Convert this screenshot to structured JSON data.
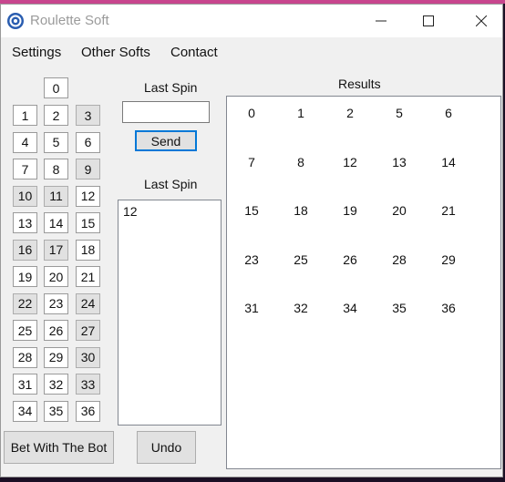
{
  "window": {
    "title": "Roulette Soft",
    "controls": [
      "minimize-icon",
      "maximize-icon",
      "close-icon"
    ]
  },
  "menu": [
    "Settings",
    "Other Softs",
    "Contact"
  ],
  "number_grid": {
    "zero": "0",
    "rows": [
      [
        "1",
        "2",
        "3"
      ],
      [
        "4",
        "5",
        "6"
      ],
      [
        "7",
        "8",
        "9"
      ],
      [
        "10",
        "11",
        "12"
      ],
      [
        "13",
        "14",
        "15"
      ],
      [
        "16",
        "17",
        "18"
      ],
      [
        "19",
        "20",
        "21"
      ],
      [
        "22",
        "23",
        "24"
      ],
      [
        "25",
        "26",
        "27"
      ],
      [
        "28",
        "29",
        "30"
      ],
      [
        "31",
        "32",
        "33"
      ],
      [
        "34",
        "35",
        "36"
      ]
    ]
  },
  "last_spin_input": {
    "label": "Last Spin",
    "value": ""
  },
  "send_button": "Send",
  "last_spin_list": {
    "label": "Last Spin",
    "items": [
      "12"
    ]
  },
  "results": {
    "label": "Results",
    "rows": [
      [
        "0",
        "1",
        "2",
        "5",
        "6"
      ],
      [
        "7",
        "8",
        "12",
        "13",
        "14"
      ],
      [
        "15",
        "18",
        "19",
        "20",
        "21"
      ],
      [
        "23",
        "25",
        "26",
        "28",
        "29"
      ],
      [
        "31",
        "32",
        "34",
        "35",
        "36"
      ]
    ]
  },
  "bet_button": "Bet With The Bot",
  "undo_button": "Undo",
  "colors": {
    "accent": "#0078d7",
    "top_bar": "#c8468e"
  }
}
